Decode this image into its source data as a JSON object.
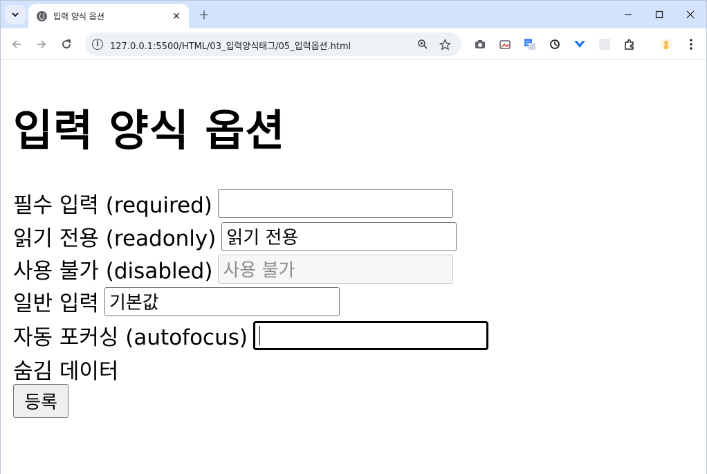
{
  "browser": {
    "tab_title": "입력 양식 옵션",
    "url": "127.0.0.1:5500/HTML/03_입력양식태그/05_입력옵션.html"
  },
  "page": {
    "heading": "입력 양식 옵션",
    "fields": [
      {
        "label": "필수 입력 (required)",
        "value": ""
      },
      {
        "label": "읽기 전용 (readonly)",
        "value": "읽기 전용"
      },
      {
        "label": "사용 불가 (disabled)",
        "value": "사용 불가"
      },
      {
        "label": "일반 입력",
        "value": "기본값"
      },
      {
        "label": "자동 포커싱 (autofocus)",
        "value": ""
      },
      {
        "label": "숨김 데이터"
      }
    ],
    "submit_label": "등록"
  }
}
